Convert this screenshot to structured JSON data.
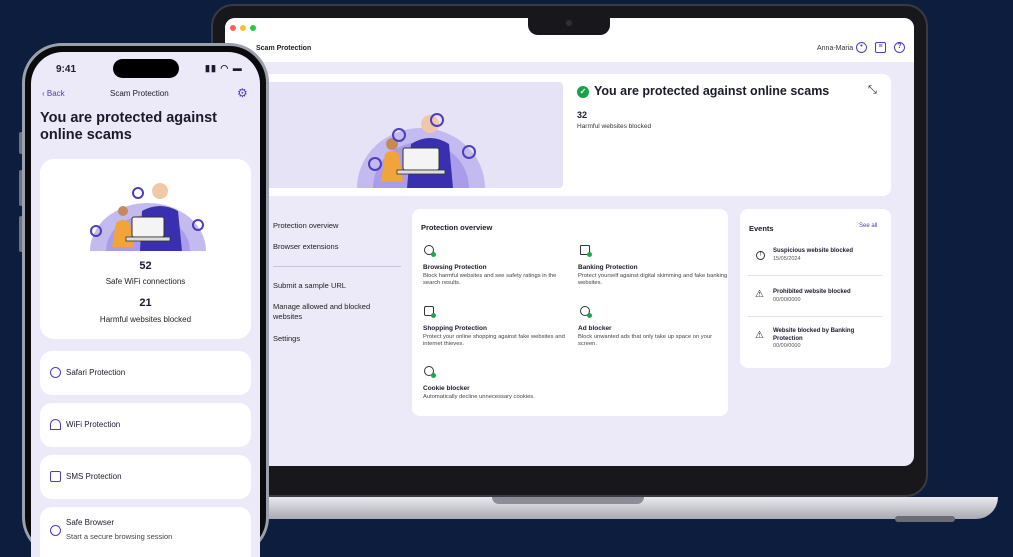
{
  "laptop": {
    "title": "Scam Protection",
    "user": "Anna-Maria",
    "hero": {
      "title": "You are protected against online scams",
      "count": "32",
      "count_label": "Harmful websites blocked"
    },
    "nav": [
      "Protection overview",
      "Browser extensions",
      "Submit a sample URL",
      "Manage allowed and blocked websites",
      "Settings"
    ],
    "overview": {
      "title": "Protection overview",
      "features": [
        {
          "name": "Browsing Protection",
          "desc": "Block harmful websites and see safety ratings in the search results."
        },
        {
          "name": "Banking Protection",
          "desc": "Protect yourself against digital skimming and fake banking websites."
        },
        {
          "name": "Shopping Protection",
          "desc": "Protect your online shopping against fake websites and internet thieves."
        },
        {
          "name": "Ad blocker",
          "desc": "Block unwanted ads that only take up space on your screen."
        },
        {
          "name": "Cookie blocker",
          "desc": "Automatically decline unnecessary cookies."
        }
      ]
    },
    "events": {
      "title": "Events",
      "see_all": "See all",
      "items": [
        {
          "title": "Suspicious website blocked",
          "date": "15/05/2024"
        },
        {
          "title": "Prohibited website blocked",
          "date": "00/00/0000"
        },
        {
          "title": "Website blocked by Banking Protection",
          "date": "00/00/0000"
        }
      ]
    }
  },
  "phone": {
    "time": "9:41",
    "back": "Back",
    "nav_title": "Scam Protection",
    "title": "You are protected against online scams",
    "stat1_num": "52",
    "stat1_label": "Safe WiFi connections",
    "stat2_num": "21",
    "stat2_label": "Harmful websites blocked",
    "items": [
      "Safari Protection",
      "WiFi Protection",
      "SMS Protection",
      "Safe Browser"
    ],
    "safe_browser_sub": "Start a secure browsing session"
  },
  "colors": {
    "accent": "#4b3fbf",
    "success": "#17a24a",
    "background": "#0d1d3d"
  }
}
